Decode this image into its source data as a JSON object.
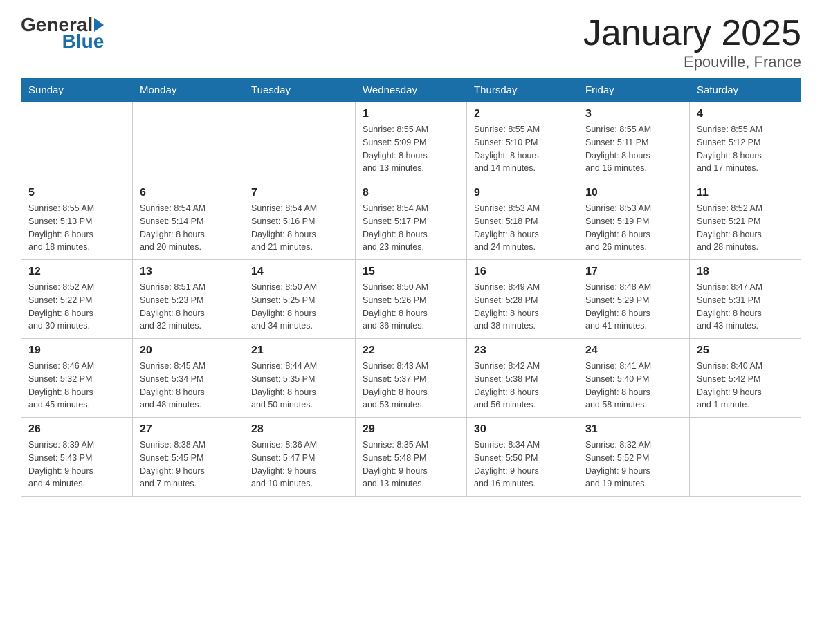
{
  "header": {
    "logo_general": "General",
    "logo_blue": "Blue",
    "title": "January 2025",
    "subtitle": "Epouville, France"
  },
  "days_of_week": [
    "Sunday",
    "Monday",
    "Tuesday",
    "Wednesday",
    "Thursday",
    "Friday",
    "Saturday"
  ],
  "weeks": [
    [
      {
        "day": "",
        "info": ""
      },
      {
        "day": "",
        "info": ""
      },
      {
        "day": "",
        "info": ""
      },
      {
        "day": "1",
        "info": "Sunrise: 8:55 AM\nSunset: 5:09 PM\nDaylight: 8 hours\nand 13 minutes."
      },
      {
        "day": "2",
        "info": "Sunrise: 8:55 AM\nSunset: 5:10 PM\nDaylight: 8 hours\nand 14 minutes."
      },
      {
        "day": "3",
        "info": "Sunrise: 8:55 AM\nSunset: 5:11 PM\nDaylight: 8 hours\nand 16 minutes."
      },
      {
        "day": "4",
        "info": "Sunrise: 8:55 AM\nSunset: 5:12 PM\nDaylight: 8 hours\nand 17 minutes."
      }
    ],
    [
      {
        "day": "5",
        "info": "Sunrise: 8:55 AM\nSunset: 5:13 PM\nDaylight: 8 hours\nand 18 minutes."
      },
      {
        "day": "6",
        "info": "Sunrise: 8:54 AM\nSunset: 5:14 PM\nDaylight: 8 hours\nand 20 minutes."
      },
      {
        "day": "7",
        "info": "Sunrise: 8:54 AM\nSunset: 5:16 PM\nDaylight: 8 hours\nand 21 minutes."
      },
      {
        "day": "8",
        "info": "Sunrise: 8:54 AM\nSunset: 5:17 PM\nDaylight: 8 hours\nand 23 minutes."
      },
      {
        "day": "9",
        "info": "Sunrise: 8:53 AM\nSunset: 5:18 PM\nDaylight: 8 hours\nand 24 minutes."
      },
      {
        "day": "10",
        "info": "Sunrise: 8:53 AM\nSunset: 5:19 PM\nDaylight: 8 hours\nand 26 minutes."
      },
      {
        "day": "11",
        "info": "Sunrise: 8:52 AM\nSunset: 5:21 PM\nDaylight: 8 hours\nand 28 minutes."
      }
    ],
    [
      {
        "day": "12",
        "info": "Sunrise: 8:52 AM\nSunset: 5:22 PM\nDaylight: 8 hours\nand 30 minutes."
      },
      {
        "day": "13",
        "info": "Sunrise: 8:51 AM\nSunset: 5:23 PM\nDaylight: 8 hours\nand 32 minutes."
      },
      {
        "day": "14",
        "info": "Sunrise: 8:50 AM\nSunset: 5:25 PM\nDaylight: 8 hours\nand 34 minutes."
      },
      {
        "day": "15",
        "info": "Sunrise: 8:50 AM\nSunset: 5:26 PM\nDaylight: 8 hours\nand 36 minutes."
      },
      {
        "day": "16",
        "info": "Sunrise: 8:49 AM\nSunset: 5:28 PM\nDaylight: 8 hours\nand 38 minutes."
      },
      {
        "day": "17",
        "info": "Sunrise: 8:48 AM\nSunset: 5:29 PM\nDaylight: 8 hours\nand 41 minutes."
      },
      {
        "day": "18",
        "info": "Sunrise: 8:47 AM\nSunset: 5:31 PM\nDaylight: 8 hours\nand 43 minutes."
      }
    ],
    [
      {
        "day": "19",
        "info": "Sunrise: 8:46 AM\nSunset: 5:32 PM\nDaylight: 8 hours\nand 45 minutes."
      },
      {
        "day": "20",
        "info": "Sunrise: 8:45 AM\nSunset: 5:34 PM\nDaylight: 8 hours\nand 48 minutes."
      },
      {
        "day": "21",
        "info": "Sunrise: 8:44 AM\nSunset: 5:35 PM\nDaylight: 8 hours\nand 50 minutes."
      },
      {
        "day": "22",
        "info": "Sunrise: 8:43 AM\nSunset: 5:37 PM\nDaylight: 8 hours\nand 53 minutes."
      },
      {
        "day": "23",
        "info": "Sunrise: 8:42 AM\nSunset: 5:38 PM\nDaylight: 8 hours\nand 56 minutes."
      },
      {
        "day": "24",
        "info": "Sunrise: 8:41 AM\nSunset: 5:40 PM\nDaylight: 8 hours\nand 58 minutes."
      },
      {
        "day": "25",
        "info": "Sunrise: 8:40 AM\nSunset: 5:42 PM\nDaylight: 9 hours\nand 1 minute."
      }
    ],
    [
      {
        "day": "26",
        "info": "Sunrise: 8:39 AM\nSunset: 5:43 PM\nDaylight: 9 hours\nand 4 minutes."
      },
      {
        "day": "27",
        "info": "Sunrise: 8:38 AM\nSunset: 5:45 PM\nDaylight: 9 hours\nand 7 minutes."
      },
      {
        "day": "28",
        "info": "Sunrise: 8:36 AM\nSunset: 5:47 PM\nDaylight: 9 hours\nand 10 minutes."
      },
      {
        "day": "29",
        "info": "Sunrise: 8:35 AM\nSunset: 5:48 PM\nDaylight: 9 hours\nand 13 minutes."
      },
      {
        "day": "30",
        "info": "Sunrise: 8:34 AM\nSunset: 5:50 PM\nDaylight: 9 hours\nand 16 minutes."
      },
      {
        "day": "31",
        "info": "Sunrise: 8:32 AM\nSunset: 5:52 PM\nDaylight: 9 hours\nand 19 minutes."
      },
      {
        "day": "",
        "info": ""
      }
    ]
  ]
}
